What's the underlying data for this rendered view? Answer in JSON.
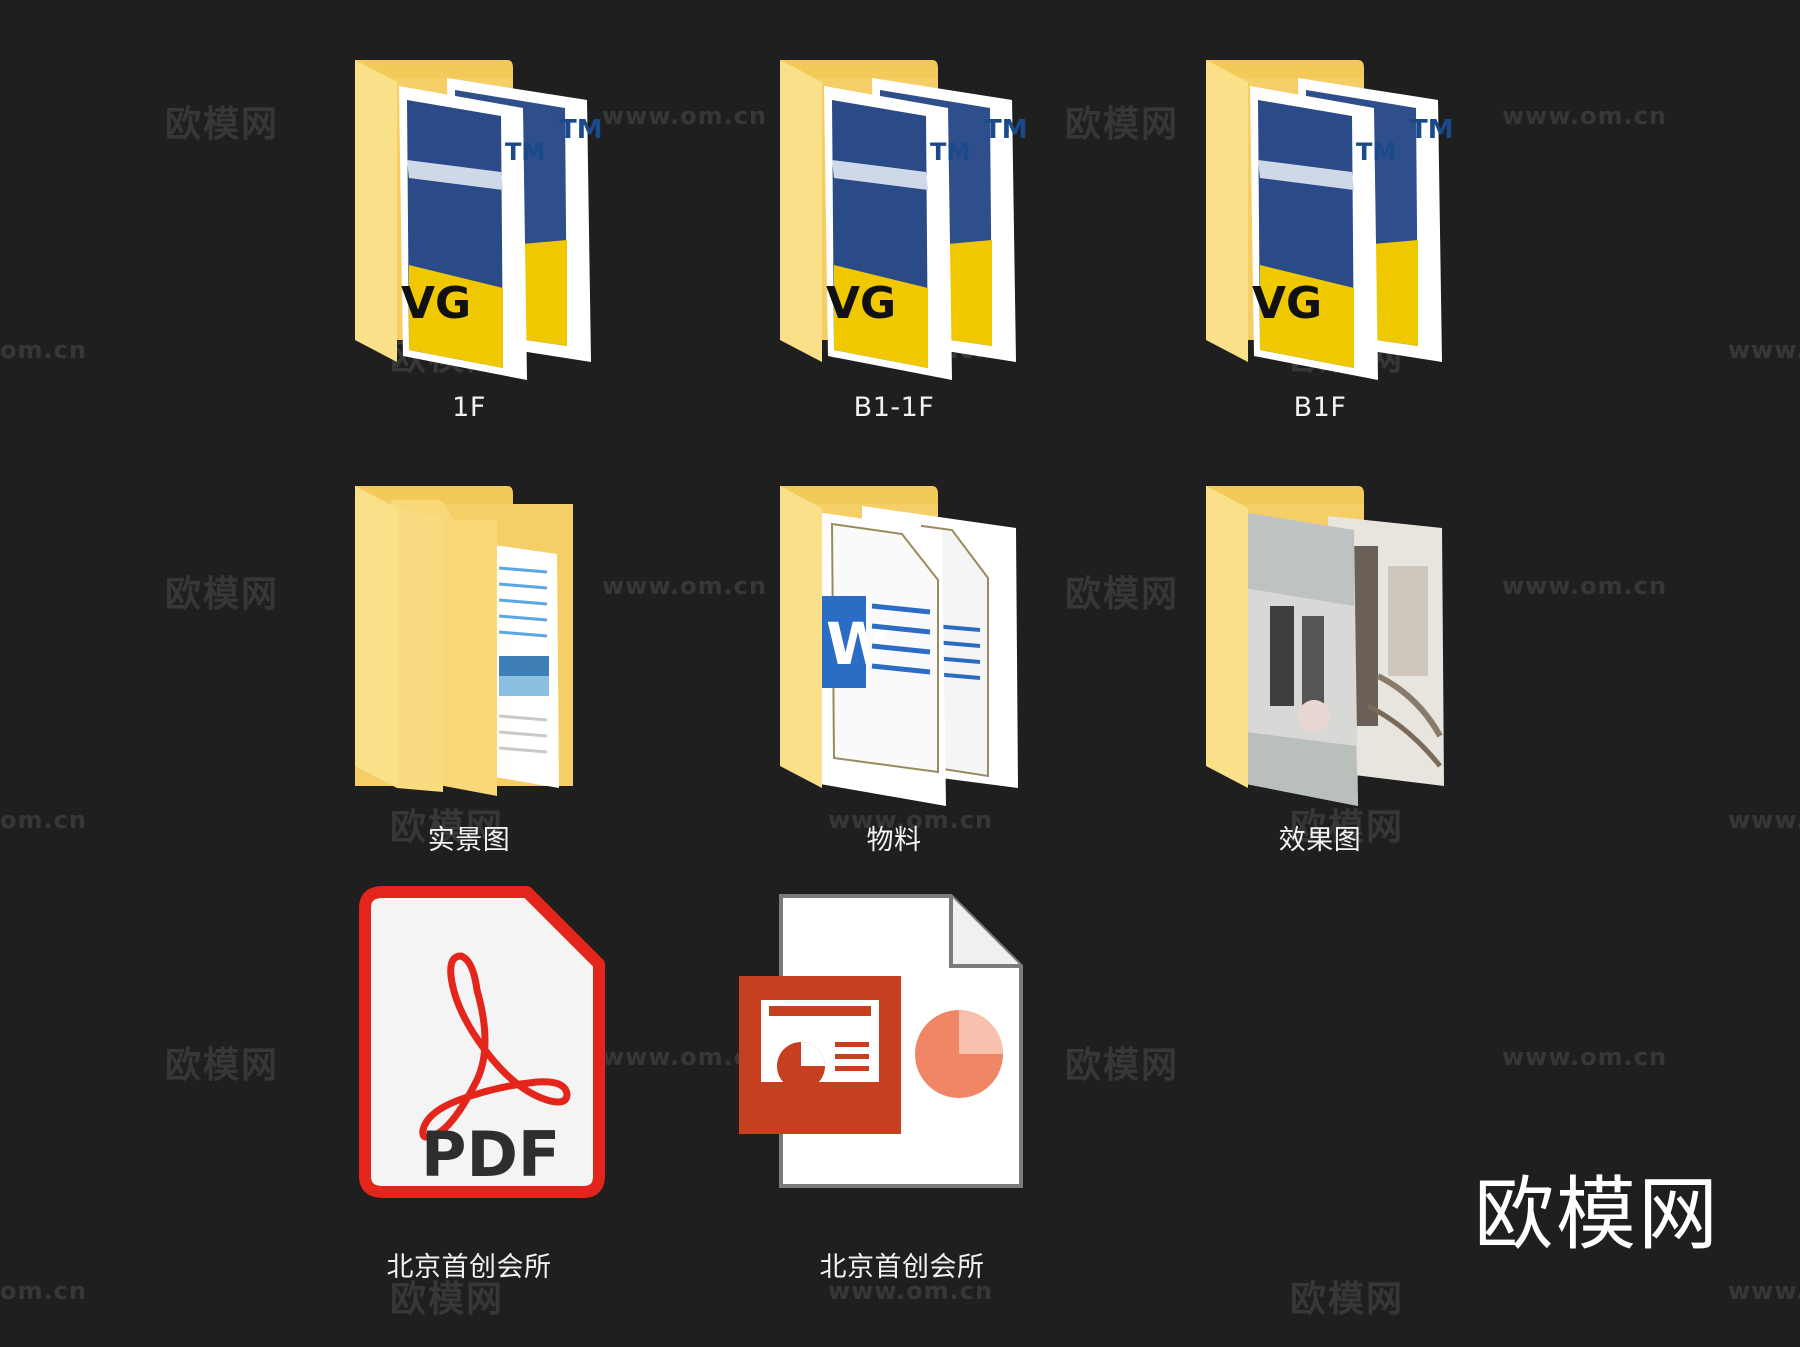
{
  "items": [
    {
      "id": "1f",
      "label": "1F",
      "type": "folder-dwg"
    },
    {
      "id": "b1-1f",
      "label": "B1-1F",
      "type": "folder-dwg"
    },
    {
      "id": "b1f",
      "label": "B1F",
      "type": "folder-dwg"
    },
    {
      "id": "photos",
      "label": "实景图",
      "type": "folder-docs"
    },
    {
      "id": "materials",
      "label": "物料",
      "type": "folder-word"
    },
    {
      "id": "renders",
      "label": "效果图",
      "type": "folder-image"
    },
    {
      "id": "pdf",
      "label": "北京首创会所",
      "type": "pdf-file"
    },
    {
      "id": "ppt",
      "label": "北京首创会所",
      "type": "ppt-file"
    }
  ],
  "icon_text": {
    "dwg_tm": "TM",
    "dwg_vg": "VG",
    "pdf": "PDF"
  },
  "watermark": {
    "cn": "欧模网",
    "url": "www.om.cn",
    "url_partial_left": "om.cn",
    "url_partial_right": "www.",
    "logo": "欧模网"
  },
  "colors": {
    "background": "#1f1f1f",
    "folder": "#f8d775",
    "pdf_red": "#e3251c",
    "ppt_orange": "#c6401f"
  }
}
